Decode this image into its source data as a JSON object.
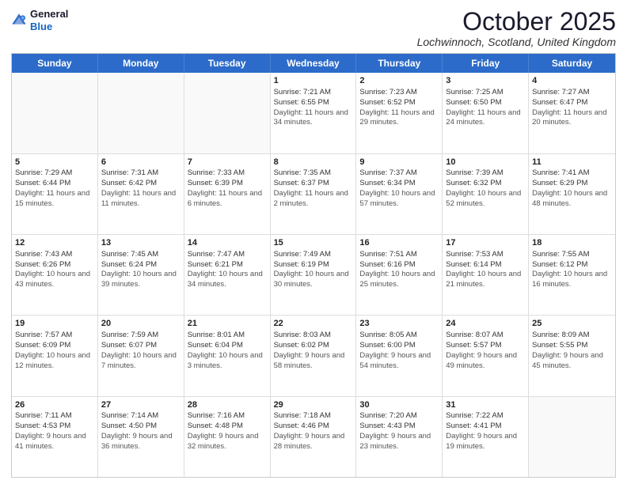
{
  "header": {
    "logo_line1": "General",
    "logo_line2": "Blue",
    "month": "October 2025",
    "location": "Lochwinnoch, Scotland, United Kingdom"
  },
  "days_of_week": [
    "Sunday",
    "Monday",
    "Tuesday",
    "Wednesday",
    "Thursday",
    "Friday",
    "Saturday"
  ],
  "weeks": [
    [
      {
        "day": "",
        "sunrise": "",
        "sunset": "",
        "daylight": ""
      },
      {
        "day": "",
        "sunrise": "",
        "sunset": "",
        "daylight": ""
      },
      {
        "day": "",
        "sunrise": "",
        "sunset": "",
        "daylight": ""
      },
      {
        "day": "1",
        "sunrise": "Sunrise: 7:21 AM",
        "sunset": "Sunset: 6:55 PM",
        "daylight": "Daylight: 11 hours and 34 minutes."
      },
      {
        "day": "2",
        "sunrise": "Sunrise: 7:23 AM",
        "sunset": "Sunset: 6:52 PM",
        "daylight": "Daylight: 11 hours and 29 minutes."
      },
      {
        "day": "3",
        "sunrise": "Sunrise: 7:25 AM",
        "sunset": "Sunset: 6:50 PM",
        "daylight": "Daylight: 11 hours and 24 minutes."
      },
      {
        "day": "4",
        "sunrise": "Sunrise: 7:27 AM",
        "sunset": "Sunset: 6:47 PM",
        "daylight": "Daylight: 11 hours and 20 minutes."
      }
    ],
    [
      {
        "day": "5",
        "sunrise": "Sunrise: 7:29 AM",
        "sunset": "Sunset: 6:44 PM",
        "daylight": "Daylight: 11 hours and 15 minutes."
      },
      {
        "day": "6",
        "sunrise": "Sunrise: 7:31 AM",
        "sunset": "Sunset: 6:42 PM",
        "daylight": "Daylight: 11 hours and 11 minutes."
      },
      {
        "day": "7",
        "sunrise": "Sunrise: 7:33 AM",
        "sunset": "Sunset: 6:39 PM",
        "daylight": "Daylight: 11 hours and 6 minutes."
      },
      {
        "day": "8",
        "sunrise": "Sunrise: 7:35 AM",
        "sunset": "Sunset: 6:37 PM",
        "daylight": "Daylight: 11 hours and 2 minutes."
      },
      {
        "day": "9",
        "sunrise": "Sunrise: 7:37 AM",
        "sunset": "Sunset: 6:34 PM",
        "daylight": "Daylight: 10 hours and 57 minutes."
      },
      {
        "day": "10",
        "sunrise": "Sunrise: 7:39 AM",
        "sunset": "Sunset: 6:32 PM",
        "daylight": "Daylight: 10 hours and 52 minutes."
      },
      {
        "day": "11",
        "sunrise": "Sunrise: 7:41 AM",
        "sunset": "Sunset: 6:29 PM",
        "daylight": "Daylight: 10 hours and 48 minutes."
      }
    ],
    [
      {
        "day": "12",
        "sunrise": "Sunrise: 7:43 AM",
        "sunset": "Sunset: 6:26 PM",
        "daylight": "Daylight: 10 hours and 43 minutes."
      },
      {
        "day": "13",
        "sunrise": "Sunrise: 7:45 AM",
        "sunset": "Sunset: 6:24 PM",
        "daylight": "Daylight: 10 hours and 39 minutes."
      },
      {
        "day": "14",
        "sunrise": "Sunrise: 7:47 AM",
        "sunset": "Sunset: 6:21 PM",
        "daylight": "Daylight: 10 hours and 34 minutes."
      },
      {
        "day": "15",
        "sunrise": "Sunrise: 7:49 AM",
        "sunset": "Sunset: 6:19 PM",
        "daylight": "Daylight: 10 hours and 30 minutes."
      },
      {
        "day": "16",
        "sunrise": "Sunrise: 7:51 AM",
        "sunset": "Sunset: 6:16 PM",
        "daylight": "Daylight: 10 hours and 25 minutes."
      },
      {
        "day": "17",
        "sunrise": "Sunrise: 7:53 AM",
        "sunset": "Sunset: 6:14 PM",
        "daylight": "Daylight: 10 hours and 21 minutes."
      },
      {
        "day": "18",
        "sunrise": "Sunrise: 7:55 AM",
        "sunset": "Sunset: 6:12 PM",
        "daylight": "Daylight: 10 hours and 16 minutes."
      }
    ],
    [
      {
        "day": "19",
        "sunrise": "Sunrise: 7:57 AM",
        "sunset": "Sunset: 6:09 PM",
        "daylight": "Daylight: 10 hours and 12 minutes."
      },
      {
        "day": "20",
        "sunrise": "Sunrise: 7:59 AM",
        "sunset": "Sunset: 6:07 PM",
        "daylight": "Daylight: 10 hours and 7 minutes."
      },
      {
        "day": "21",
        "sunrise": "Sunrise: 8:01 AM",
        "sunset": "Sunset: 6:04 PM",
        "daylight": "Daylight: 10 hours and 3 minutes."
      },
      {
        "day": "22",
        "sunrise": "Sunrise: 8:03 AM",
        "sunset": "Sunset: 6:02 PM",
        "daylight": "Daylight: 9 hours and 58 minutes."
      },
      {
        "day": "23",
        "sunrise": "Sunrise: 8:05 AM",
        "sunset": "Sunset: 6:00 PM",
        "daylight": "Daylight: 9 hours and 54 minutes."
      },
      {
        "day": "24",
        "sunrise": "Sunrise: 8:07 AM",
        "sunset": "Sunset: 5:57 PM",
        "daylight": "Daylight: 9 hours and 49 minutes."
      },
      {
        "day": "25",
        "sunrise": "Sunrise: 8:09 AM",
        "sunset": "Sunset: 5:55 PM",
        "daylight": "Daylight: 9 hours and 45 minutes."
      }
    ],
    [
      {
        "day": "26",
        "sunrise": "Sunrise: 7:11 AM",
        "sunset": "Sunset: 4:53 PM",
        "daylight": "Daylight: 9 hours and 41 minutes."
      },
      {
        "day": "27",
        "sunrise": "Sunrise: 7:14 AM",
        "sunset": "Sunset: 4:50 PM",
        "daylight": "Daylight: 9 hours and 36 minutes."
      },
      {
        "day": "28",
        "sunrise": "Sunrise: 7:16 AM",
        "sunset": "Sunset: 4:48 PM",
        "daylight": "Daylight: 9 hours and 32 minutes."
      },
      {
        "day": "29",
        "sunrise": "Sunrise: 7:18 AM",
        "sunset": "Sunset: 4:46 PM",
        "daylight": "Daylight: 9 hours and 28 minutes."
      },
      {
        "day": "30",
        "sunrise": "Sunrise: 7:20 AM",
        "sunset": "Sunset: 4:43 PM",
        "daylight": "Daylight: 9 hours and 23 minutes."
      },
      {
        "day": "31",
        "sunrise": "Sunrise: 7:22 AM",
        "sunset": "Sunset: 4:41 PM",
        "daylight": "Daylight: 9 hours and 19 minutes."
      },
      {
        "day": "",
        "sunrise": "",
        "sunset": "",
        "daylight": ""
      }
    ]
  ]
}
